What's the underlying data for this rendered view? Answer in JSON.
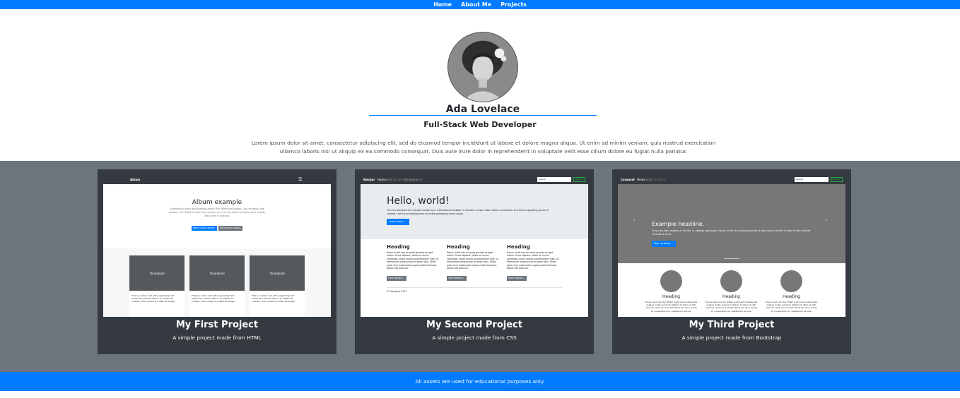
{
  "nav": {
    "items": [
      "Home",
      "About Me",
      "Projects"
    ]
  },
  "profile": {
    "name": "Ada Lovelace",
    "role": "Full-Stack Web Developer",
    "bio": "Lorem ipsum dolor sit amet, consectetur adipiscing elit, sed do eiusmod tempor incididunt ut labore et dolore magna aliqua. Ut enim ad minim veniam, quis nostrud exercitation ullamco laboris nisi ut aliquip ex ea commodo consequat. Duis aute irure dolor in reprehenderit in voluptate velit esse cillum dolore eu fugiat nulla pariatur."
  },
  "projects": [
    {
      "title": "My First Project",
      "description": "A simple project made from HTML",
      "preview": {
        "brand": "Album",
        "heading": "Album example",
        "text": "Something short and leading about the collection below—its contents, the creator, etc. Make it short and sweet, but not too short so folks don't simply skip over it entirely.",
        "button1": "Main call to action",
        "button2": "Secondary action",
        "thumb_label": "Thumbnail",
        "card_text": "This is a wider card with supporting text below as a natural lead-in to additional content. This content is a little bit longer.",
        "view": "View",
        "edit": "Edit",
        "mins": "9 mins"
      }
    },
    {
      "title": "My Second Project",
      "description": "A simple project made from CSS",
      "preview": {
        "brand": "Navbar",
        "links": [
          "Home",
          "Link",
          "Disabled",
          "Dropdown ▾"
        ],
        "search": "Search",
        "search_btn": "Search",
        "heading": "Hello, world!",
        "text": "This is a template for a simple marketing or informational website. It includes a large callout called a jumbotron and three supporting pieces of content. Use it as a starting point to create something more unique.",
        "cta": "Learn more »",
        "col_heading": "Heading",
        "col_text": "Donec id elit non mi porta gravida at eget metus. Fusce dapibus, tellus ac cursus commodo, tortor mauris condimentum nibh, ut fermentum massa justo sit amet risus. Etiam porta sem malesuada magna mollis euismod. Donec sed odio dui.",
        "col_btn": "View details »",
        "footer": "© Company 2017"
      }
    },
    {
      "title": "My Third Project",
      "description": "A simple project made from Bootstrap",
      "preview": {
        "brand": "Carousel",
        "links": [
          "Home",
          "Link",
          "Disabled"
        ],
        "search": "Search",
        "search_btn": "Search",
        "headline": "Example headline.",
        "text": "Cras justo odio, dapibus ac facilisis in, egestas eget quam. Donec id elit non mi porta gravida at eget metus. Nullam id dolor id nibh ultricies vehicula ut id elit.",
        "cta": "Sign up today",
        "col_heading": "Heading",
        "col_text": "Donec sed odio dui. Etiam porta sem malesuada magna mollis euismod. Nullam id dolor id nibh ultricies vehicula ut id elit. Morbi leo risus, porta ac consectetur ac, vestibulum at eros."
      }
    }
  ],
  "footer": {
    "text": "All assets are used for educational purposes only."
  },
  "colors": {
    "primary": "#007bff",
    "dark": "#343a40",
    "gray": "#6c757d"
  }
}
